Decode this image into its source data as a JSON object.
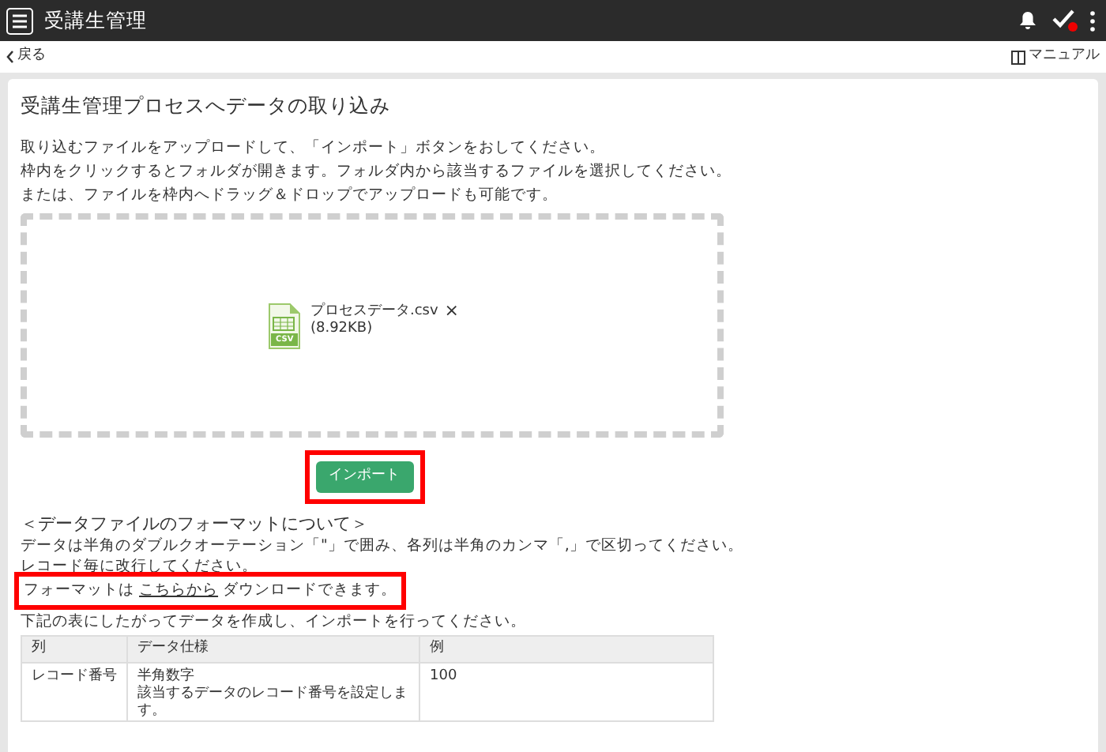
{
  "app_bar": {
    "title": "受講生管理",
    "notification_badge": true
  },
  "sub_bar": {
    "back": "戻る",
    "manual": "マニュアル"
  },
  "card": {
    "title": "受講生管理プロセスへデータの取り込み",
    "instructions": [
      "取り込むファイルをアップロードして、「インポート」ボタンをおしてください。",
      "枠内をクリックするとフォルダが開きます。フォルダ内から該当するファイルを選択してください。",
      "または、ファイルを枠内へドラッグ＆ドロップでアップロードも可能です。"
    ],
    "file": {
      "name": "プロセスデータ.csv",
      "size": "(8.92KB)",
      "remove": "×",
      "type_label": "CSV"
    },
    "import_button": {
      "label": "インポート",
      "highlighted": true
    },
    "format_heading": "＜データファイルのフォーマットについて＞",
    "format_notes": [
      "データは半角のダブルクオーテーション「\"」で囲み、各列は半角のカンマ「,」で区切ってください。",
      "レコード毎に改行してください。"
    ],
    "download_line": {
      "before": "フォーマットは",
      "link": "こちらから",
      "after": "ダウンロードできます。",
      "highlighted": true
    },
    "table_intro": "下記の表にしたがってデータを作成し、インポートを行ってください。",
    "table": {
      "columns": [
        "列",
        "データ仕様",
        "例"
      ],
      "rows": [
        {
          "cells": [
            [
              "レコード番号"
            ],
            [
              "半角数字",
              "該当するデータのレコード番号を設定します。"
            ],
            [
              "100"
            ]
          ]
        }
      ]
    }
  }
}
